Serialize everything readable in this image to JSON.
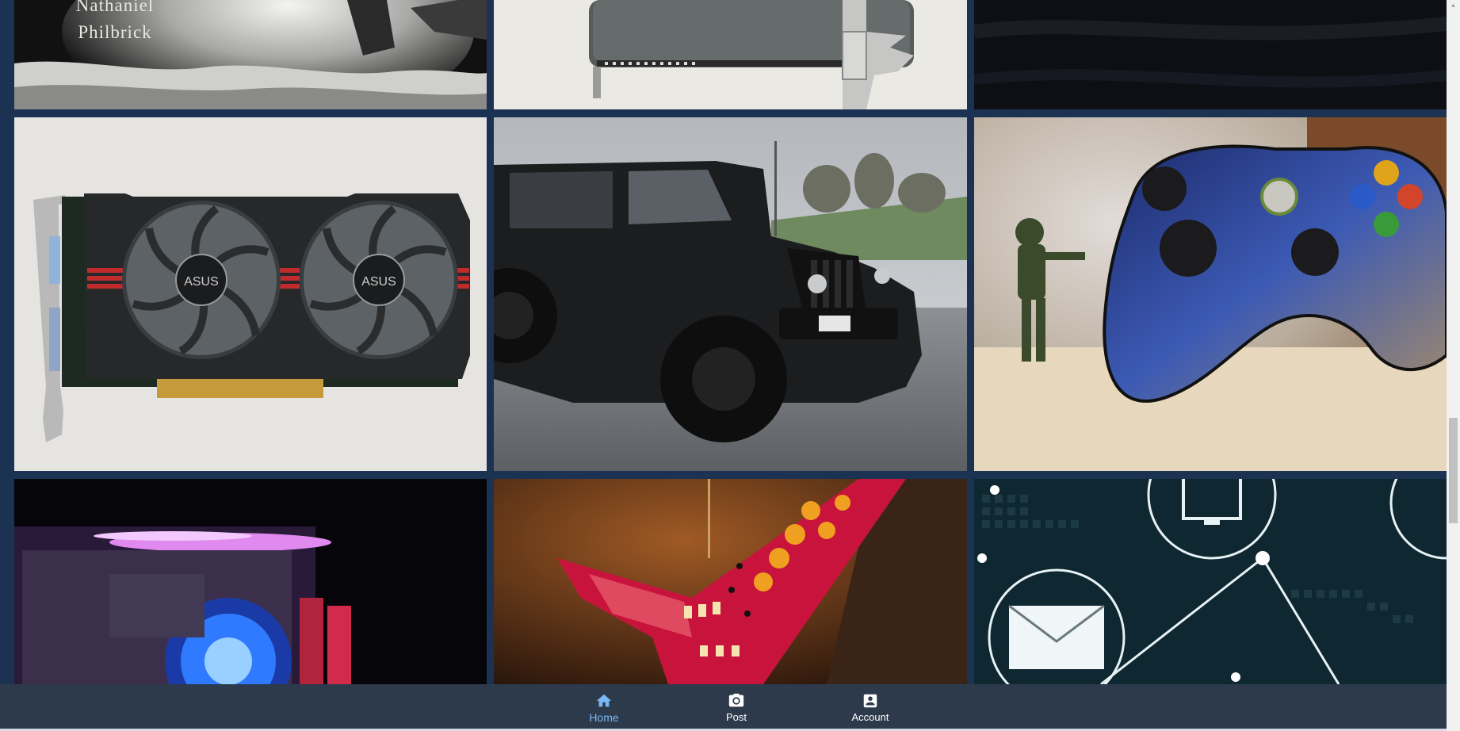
{
  "gallery": {
    "tiles": [
      {
        "name": "book-cover",
        "text_line1": "Nathaniel",
        "text_line2": "Philbrick"
      },
      {
        "name": "router-hardware"
      },
      {
        "name": "dark-fabric"
      },
      {
        "name": "graphics-card"
      },
      {
        "name": "black-jeep"
      },
      {
        "name": "halo-controller"
      },
      {
        "name": "rgb-pc-internals"
      },
      {
        "name": "star-lantern"
      },
      {
        "name": "network-graphic"
      }
    ]
  },
  "nav": {
    "items": [
      {
        "label": "Home",
        "icon": "home-icon",
        "active": true
      },
      {
        "label": "Post",
        "icon": "camera-icon",
        "active": false
      },
      {
        "label": "Account",
        "icon": "account-box-icon",
        "active": false
      }
    ],
    "active_color": "#7ab8f5",
    "background": "#2c3a4b"
  },
  "scrollbar": {
    "arrow_up": "▲"
  }
}
